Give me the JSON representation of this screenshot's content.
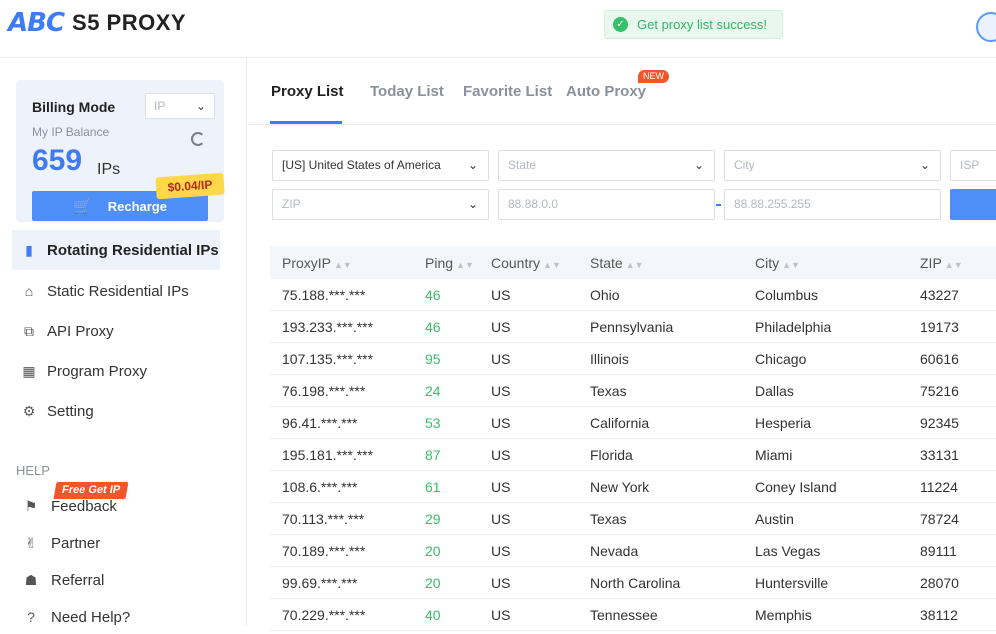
{
  "header": {
    "logo_mark": "ABC",
    "logo_text": "S5 PROXY",
    "toast": "Get proxy list success!"
  },
  "billing": {
    "title": "Billing Mode",
    "mode_value": "IP",
    "balance_label": "My IP Balance",
    "balance": "659",
    "balance_unit": "IPs",
    "price_tag": "$0.04/IP",
    "recharge_label": "Recharge"
  },
  "nav": {
    "items": [
      {
        "label": "Rotating Residential IPs",
        "icon": "phone-icon"
      },
      {
        "label": "Static Residential IPs",
        "icon": "home-icon"
      },
      {
        "label": "API Proxy",
        "icon": "plug-icon"
      },
      {
        "label": "Program Proxy",
        "icon": "grid-icon"
      },
      {
        "label": "Setting",
        "icon": "gear-icon"
      }
    ],
    "help_label": "HELP",
    "free_tag": "Free Get IP",
    "help_items": [
      {
        "label": "Feedback",
        "icon": "feedback-icon"
      },
      {
        "label": "Partner",
        "icon": "handshake-icon"
      },
      {
        "label": "Referral",
        "icon": "gift-icon"
      },
      {
        "label": "Need Help?",
        "icon": "question-icon"
      }
    ]
  },
  "tabs": {
    "items": [
      "Proxy List",
      "Today List",
      "Favorite List",
      "Auto Proxy"
    ],
    "new_badge": "NEW"
  },
  "filters": {
    "country": "[US] United States of America",
    "state_placeholder": "State",
    "city_placeholder": "City",
    "isp_placeholder": "ISP",
    "zip_placeholder": "ZIP",
    "ip_from_placeholder": "88.88.0.0",
    "ip_to_placeholder": "88.88.255.255"
  },
  "table": {
    "headers": [
      "ProxyIP",
      "Ping",
      "Country",
      "State",
      "City",
      "ZIP"
    ],
    "rows": [
      [
        "75.188.***.***",
        "46",
        "US",
        "Ohio",
        "Columbus",
        "43227"
      ],
      [
        "193.233.***.***",
        "46",
        "US",
        "Pennsylvania",
        "Philadelphia",
        "19173"
      ],
      [
        "107.135.***.***",
        "95",
        "US",
        "Illinois",
        "Chicago",
        "60616"
      ],
      [
        "76.198.***.***",
        "24",
        "US",
        "Texas",
        "Dallas",
        "75216"
      ],
      [
        "96.41.***.***",
        "53",
        "US",
        "California",
        "Hesperia",
        "92345"
      ],
      [
        "195.181.***.***",
        "87",
        "US",
        "Florida",
        "Miami",
        "33131"
      ],
      [
        "108.6.***.***",
        "61",
        "US",
        "New York",
        "Coney Island",
        "11224"
      ],
      [
        "70.113.***.***",
        "29",
        "US",
        "Texas",
        "Austin",
        "78724"
      ],
      [
        "70.189.***.***",
        "20",
        "US",
        "Nevada",
        "Las Vegas",
        "89111"
      ],
      [
        "99.69.***.***",
        "20",
        "US",
        "North Carolina",
        "Huntersville",
        "28070"
      ],
      [
        "70.229.***.***",
        "40",
        "US",
        "Tennessee",
        "Memphis",
        "38112"
      ]
    ]
  }
}
